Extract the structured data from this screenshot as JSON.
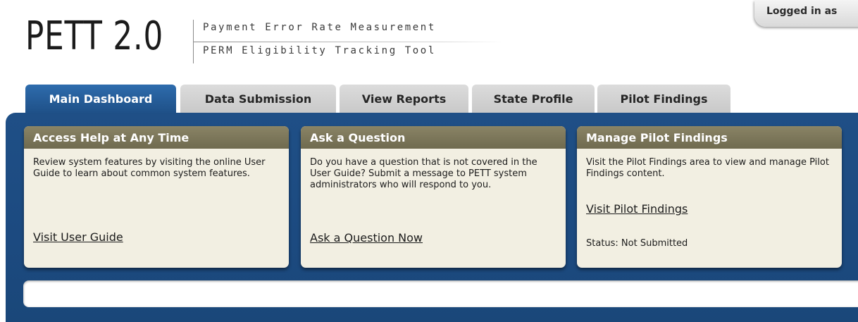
{
  "logo": {
    "mark": "PETT 2.0",
    "line1": "Payment Error Rate Measurement",
    "line2": "PERM Eligibility Tracking Tool"
  },
  "header": {
    "login_text": "Logged in as"
  },
  "tabs": [
    {
      "label": "Main Dashboard",
      "active": true
    },
    {
      "label": "Data Submission",
      "active": false
    },
    {
      "label": "View Reports",
      "active": false
    },
    {
      "label": "State Profile",
      "active": false
    },
    {
      "label": "Pilot Findings",
      "active": false
    }
  ],
  "cards": [
    {
      "title": "Access Help at Any Time",
      "body": "Review system features by visiting the online User Guide to learn about common system features.",
      "link": "Visit User Guide"
    },
    {
      "title": "Ask a Question",
      "body": "Do you have a question that is not covered in the User Guide? Submit a message to PETT system administrators who will respond to you.",
      "link": "Ask a Question Now"
    },
    {
      "title": "Manage Pilot Findings",
      "body": "Visit the Pilot Findings area to view and manage Pilot Findings content.",
      "link": "Visit Pilot Findings",
      "status": "Status: Not Submitted"
    }
  ],
  "colors": {
    "primary_blue": "#1f4f86",
    "active_tab": "#2e6cad",
    "card_header": "#7d7759",
    "card_bg": "#f2efe2",
    "inactive_tab": "#d2d2d2"
  }
}
